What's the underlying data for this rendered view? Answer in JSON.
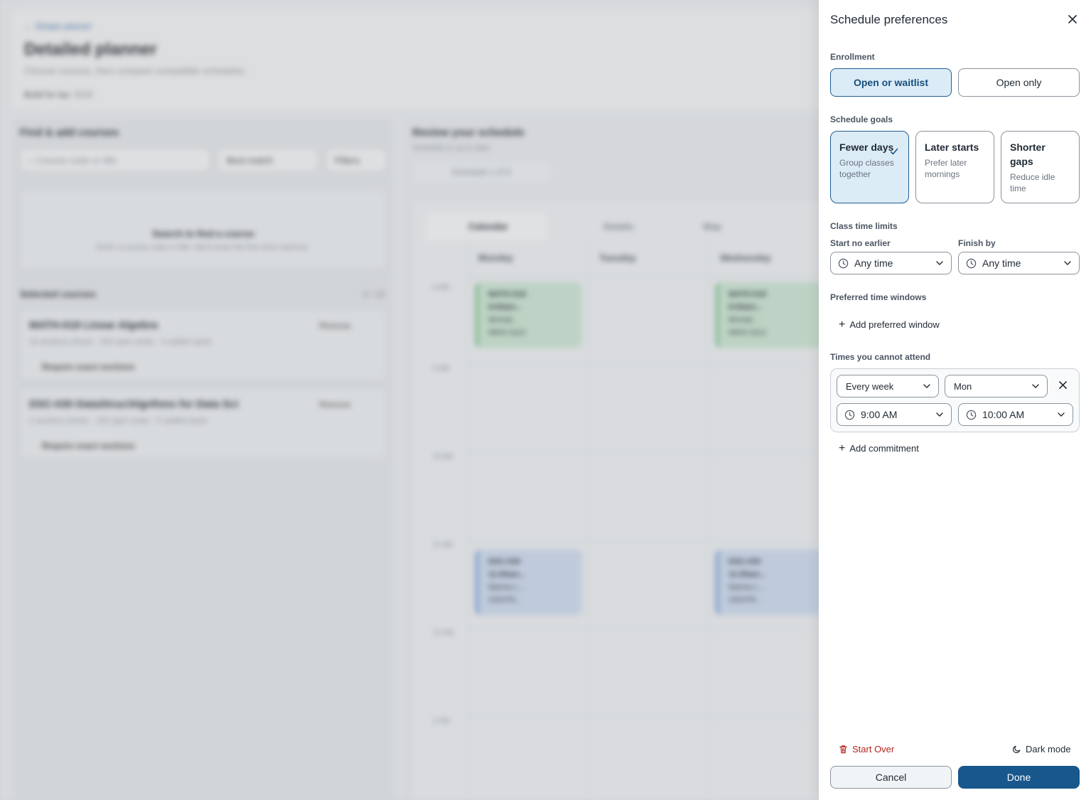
{
  "background": {
    "back_link": "Simple planner",
    "title": "Detailed planner",
    "subtitle": "Choose courses, then compare compatible schedules.",
    "term_label": "Build for tau",
    "term_value": "5526",
    "find": {
      "heading": "Find & add courses",
      "search_placeholder": "Course code or title",
      "sort": "Best match",
      "filters": "Filters",
      "empty_title": "Search to find a course",
      "empty_sub": "Enter a course code or title. We'll show the five best matches."
    },
    "selected": {
      "heading": "Selected courses",
      "count": "2 / 10",
      "courses": [
        {
          "name": "MATH-018  Linear Algebra",
          "meta": "16 sections shown · 500 open seats · 3 waitlist spots",
          "require": "Require exact sections",
          "remove": "Remove"
        },
        {
          "name": "DSC-030  DataStruc/Algrthms for Data Sci",
          "meta": "2 sections shown · 180 open seats · 5 waitlist spots",
          "require": "Require exact sections",
          "remove": "Remove"
        }
      ]
    },
    "review": {
      "heading": "Review your schedule",
      "sub": "Schedule is up to date",
      "nav": "Schedule 1 of 5",
      "tabs": [
        "Calendar",
        "Details",
        "Map"
      ],
      "days": [
        "Monday",
        "Tuesday",
        "Wednesday"
      ],
      "hours": [
        "8 AM",
        "9 AM",
        "10 AM",
        "11 AM",
        "12 PM",
        "1 PM"
      ],
      "events": [
        {
          "code": "MATH-018",
          "time": "8:00am...",
          "place": "Mcreal...",
          "room": "WKN 0113"
        },
        {
          "code": "MATH-018",
          "time": "8:00am...",
          "place": "Mcreal...",
          "room": "WKN 0113"
        },
        {
          "code": "DSC-030",
          "time": "11:00am...",
          "place": "Marine L...",
          "room": "CENTR..."
        },
        {
          "code": "DSC-030",
          "time": "11:00am...",
          "place": "Marine L...",
          "room": "CENTR..."
        }
      ]
    }
  },
  "panel": {
    "title": "Schedule preferences",
    "enrollment": {
      "label": "Enrollment",
      "options": [
        "Open or waitlist",
        "Open only"
      ],
      "selected": "Open or waitlist"
    },
    "goals": {
      "label": "Schedule goals",
      "cards": [
        {
          "title": "Fewer days",
          "desc": "Group classes together",
          "selected": true
        },
        {
          "title": "Later starts",
          "desc": "Prefer later mornings",
          "selected": false
        },
        {
          "title": "Shorter gaps",
          "desc": "Reduce idle time",
          "selected": false
        }
      ]
    },
    "limits": {
      "label": "Class time limits",
      "start_label": "Start no earlier",
      "start_value": "Any time",
      "finish_label": "Finish by",
      "finish_value": "Any time"
    },
    "windows": {
      "label": "Preferred time windows",
      "add": "Add preferred window"
    },
    "cannot": {
      "label": "Times you cannot attend",
      "frequency": "Every week",
      "day": "Mon",
      "start": "9:00 AM",
      "end": "10:00 AM",
      "add": "Add commitment"
    },
    "footer": {
      "start_over": "Start Over",
      "dark_mode": "Dark mode",
      "cancel": "Cancel",
      "done": "Done"
    }
  },
  "colors": {
    "accent": "#17578c",
    "selected_bg": "#dcecf7",
    "danger": "#b3261e"
  }
}
